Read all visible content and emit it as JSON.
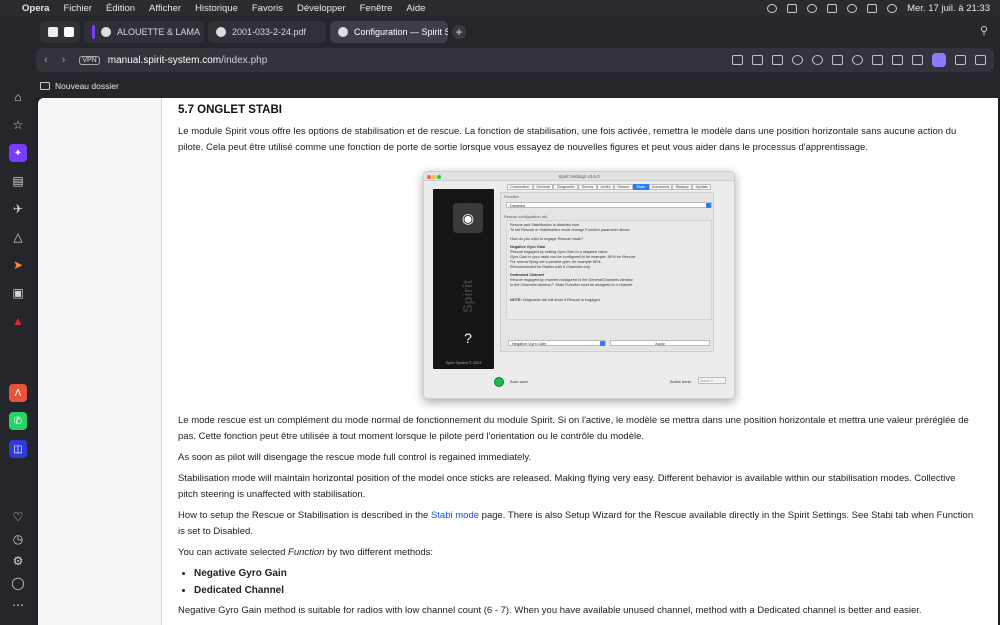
{
  "menubar": {
    "apple": "",
    "app_name": "Opera",
    "menus": [
      "Fichier",
      "Édition",
      "Afficher",
      "Historique",
      "Favoris",
      "Développer",
      "Fenêtre",
      "Aide"
    ],
    "datetime": "Mer. 17 juil. à  21:33"
  },
  "tabs": [
    {
      "label": "ALOUETTE & LAMA",
      "active": false
    },
    {
      "label": "2001-033-2-24.pdf",
      "active": false
    },
    {
      "label": "Configuration — Spirit S",
      "active": true
    }
  ],
  "newtab_label": "+",
  "addressbar": {
    "vpn": "VPN",
    "url_domain": "manual.spirit-system.com",
    "url_path": "/index.php"
  },
  "bookmarks": [
    {
      "label": "Nouveau dossier"
    }
  ],
  "article": {
    "heading": "5.7 ONGLET STABI",
    "para1": "Le module Spirit vous offre les options de stabilisation et de rescue. La fonction de stabilisation, une fois activée, remettra le modèle dans une position horizontale sans aucune action du pilote. Cela peut être utilisé comme une fonction de porte de sortie lorsque vous essayez de nouvelles figures et peut vous aider dans le processus d'apprentissage.",
    "para2": "Le mode rescue est un complément du mode normal de fonctionnement du module Spirit. Si on l'active, le modèle se mettra dans une position horizontale et mettra une valeur préréglée de pas. Cette fonction peut être utilisée à tout moment lorsque le pilote perd l'orientation ou le contrôle du modèle.",
    "para3": "As soon as pilot will disengage the rescue mode full control is regained immediately.",
    "para4": "Stabilisation mode will maintain horizontal position of the model once sticks are released. Making flying very easy. Different behavior is available within our stabilisation modes. Collective pitch steering is unaffected with stabilisation.",
    "para5_before": "How to setup the Rescue or Stabilisation is described in the ",
    "para5_link": "Stabi mode",
    "para5_after": " page. There is also Setup Wizard for the Rescue available directly in the Spirit Settings. See Stabi tab when Function is set to Disabled.",
    "para6_before": "You can activate selected ",
    "para6_em": "Function",
    "para6_after": " by two different methods:",
    "methods": [
      "Negative Gyro Gain",
      "Dedicated Channel"
    ],
    "para7": "Negative Gyro Gain method is suitable for radios with low channel count (6 - 7). When you have available unused channel, method with a Dedicated channel is better and easier."
  },
  "screenshot": {
    "window_title": "Spirit Settings v3.6.0",
    "tabs": [
      "Connection",
      "General",
      "Diagnostic",
      "Servos",
      "Limits",
      "Sensor",
      "Stabi",
      "Advanced",
      "Backup",
      "Update"
    ],
    "selected_tab": "Stabi",
    "function_label": "Function",
    "function_value": "Disabled",
    "rescue_config_label": "Rescue configuration aid",
    "info_line1": "Rescue and Stabilisation is disabled now.",
    "info_line2": "To set Rescue or Stabilisation mode change Function parameter above.",
    "info_question": "How do you wish to engage Rescue mode?",
    "ngg_title": "Negative Gyro Gain",
    "ngg_1": "Rescue engaged by setting Gyro Gain to a negative value.",
    "ngg_2": "Gyro Gain in your radio can be configured to for example -80% for Rescue.",
    "ngg_3": "For normal flying set a positive gain, for example 80%.",
    "ngg_4": "Recommended for Radios with 6 Channels only.",
    "dc_title": "Dedicated Channel",
    "dc_1": "Rescue engaged by channel configured in the General/Channels window.",
    "dc_2": "In the Channels window F. Stabi Function must be assigned to a channel.",
    "note_label": "NOTE:",
    "note_text": " Diagnostic tab will show if Rescue is engaged.",
    "method_value": "Negative Gyro Gain",
    "apply_label": "Apply",
    "copyright": "Spirit System © 2023",
    "autosave_label": "Auto save",
    "active_bank_label": "Active bank:",
    "active_bank_value": "Bank 0"
  },
  "colors": {
    "accent_purple": "#7a3cff",
    "link_blue": "#1a4fc4",
    "tab_blue": "#2f7bf5",
    "status_green": "#1fb84a"
  }
}
